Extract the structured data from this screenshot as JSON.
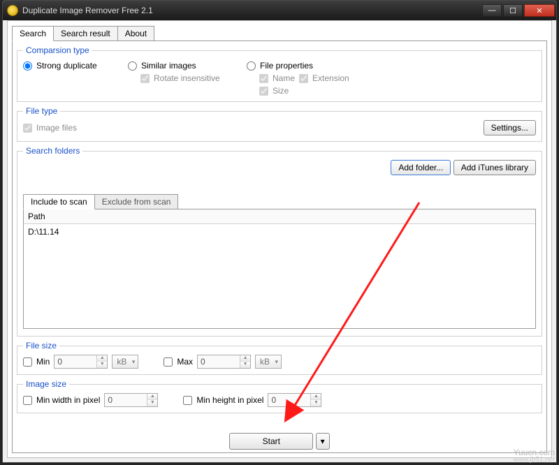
{
  "window": {
    "title": "Duplicate Image Remover Free 2.1"
  },
  "tabs": {
    "search": "Search",
    "search_result": "Search result",
    "about": "About"
  },
  "comparison": {
    "legend": "Comparsion type",
    "strong": "Strong duplicate",
    "similar": "Similar images",
    "rotate": "Rotate insensitive",
    "fileprops": "File properties",
    "name": "Name",
    "extension": "Extension",
    "size": "Size"
  },
  "filetype": {
    "legend": "File type",
    "image_files": "Image files",
    "settings_btn": "Settings..."
  },
  "folders": {
    "legend": "Search folders",
    "add_folder": "Add folder...",
    "add_itunes": "Add iTunes library",
    "include_tab": "Include to scan",
    "exclude_tab": "Exclude from scan",
    "path_header": "Path",
    "paths": [
      "D:\\11.14"
    ]
  },
  "filesize": {
    "legend": "File size",
    "min": "Min",
    "min_val": "0",
    "min_unit": "kB",
    "max": "Max",
    "max_val": "0",
    "max_unit": "kB"
  },
  "imagesize": {
    "legend": "Image size",
    "minw": "Min width in pixel",
    "minw_val": "0",
    "minh": "Min height in pixel",
    "minh_val": "0"
  },
  "start": {
    "label": "Start"
  },
  "watermark": {
    "main": "Yuucn.com",
    "sub": "www.jb51.net"
  }
}
